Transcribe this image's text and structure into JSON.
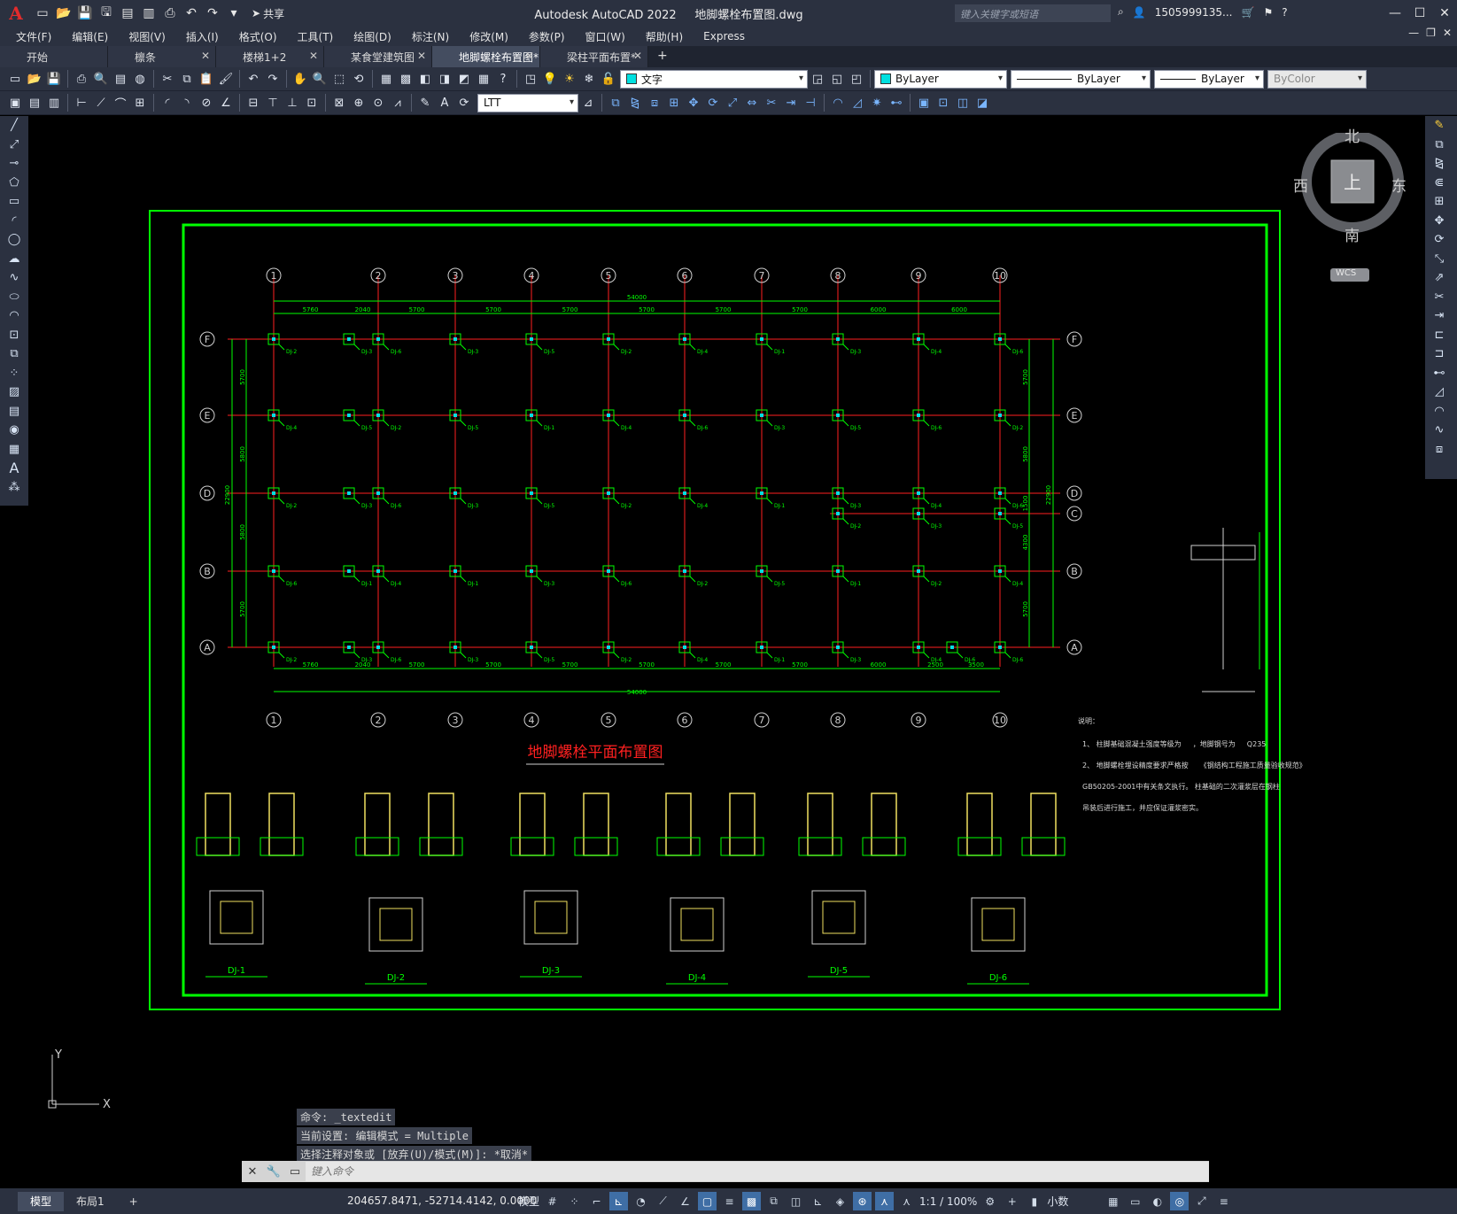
{
  "app": {
    "logo": "A",
    "title": "Autodesk AutoCAD 2022",
    "document": "地脚螺栓布置图.dwg",
    "search_placeholder": "键入关键字或短语",
    "user": "1505999135...",
    "share_label": "共享"
  },
  "menu": [
    "文件(F)",
    "编辑(E)",
    "视图(V)",
    "插入(I)",
    "格式(O)",
    "工具(T)",
    "绘图(D)",
    "标注(N)",
    "修改(M)",
    "参数(P)",
    "窗口(W)",
    "帮助(H)",
    "Express"
  ],
  "tabs": [
    {
      "label": "开始",
      "active": false
    },
    {
      "label": "檩条",
      "active": false
    },
    {
      "label": "楼梯1+2",
      "active": false
    },
    {
      "label": "某食堂建筑图",
      "active": false
    },
    {
      "label": "地脚螺栓布置图*",
      "active": true
    },
    {
      "label": "梁柱平面布置*",
      "active": false
    }
  ],
  "toolbar": {
    "text_style": "文字",
    "layer": "ByLayer",
    "linetype": "ByLayer",
    "lineweight": "ByLayer",
    "plotstyle": "ByColor",
    "ltt": "LTT"
  },
  "viewcube": {
    "north": "北",
    "south": "南",
    "east": "东",
    "west": "西",
    "top": "上",
    "wcs": "WCS"
  },
  "drawing": {
    "title": "地脚螺栓平面布置图",
    "columns": [
      "1",
      "2",
      "3",
      "4",
      "5",
      "6",
      "7",
      "8",
      "9",
      "10"
    ],
    "rows": [
      "F",
      "E",
      "D",
      "C",
      "B",
      "A"
    ],
    "total_width": "54000",
    "top_dims": [
      "5760",
      "2040",
      "5700",
      "5700",
      "5700",
      "5700",
      "5700",
      "5700",
      "6000",
      "6000"
    ],
    "bottom_dims": [
      "5760",
      "2040",
      "5700",
      "5700",
      "5700",
      "5700",
      "5700",
      "5700",
      "6000",
      "2500",
      "3500"
    ],
    "left_dims": [
      "5700",
      "5800",
      "5800",
      "5700"
    ],
    "left_total": "22900",
    "right_dims": [
      "5700",
      "5800",
      "1500",
      "4300",
      "5700"
    ],
    "right_total": "22900",
    "notes_title": "说明：",
    "notes": [
      "1、 柱脚基础混凝土强度等级为 　 ，地脚钢号为 　 Q235",
      "2、 地脚螺栓埋设精度要求严格按 　 《钢结构工程施工质量验收规范》",
      "GB50205-2001中有关条文执行。 柱基础的二次灌浆层在钢柱",
      "吊装后进行施工，并应保证灌浆密实。"
    ],
    "detail_labels": [
      "DJ-1",
      "DJ-2",
      "DJ-3",
      "DJ-4",
      "DJ-5",
      "DJ-6"
    ]
  },
  "command": {
    "history": [
      "命令: _textedit",
      "当前设置: 编辑模式 = Multiple",
      "选择注释对象或 [放弃(U)/模式(M)]: *取消*"
    ],
    "placeholder": "键入命令"
  },
  "status": {
    "layouts": [
      "模型",
      "布局1"
    ],
    "coords": "204657.8471, -52714.4142, 0.0000",
    "mode": "模型",
    "scale": "1:1 / 100%",
    "units": "小数"
  },
  "colors": {
    "grid": "#ff2020",
    "dim": "#00ff00",
    "border": "#00ff00",
    "title": "#ff2020",
    "accent": "#3f6ea5"
  }
}
